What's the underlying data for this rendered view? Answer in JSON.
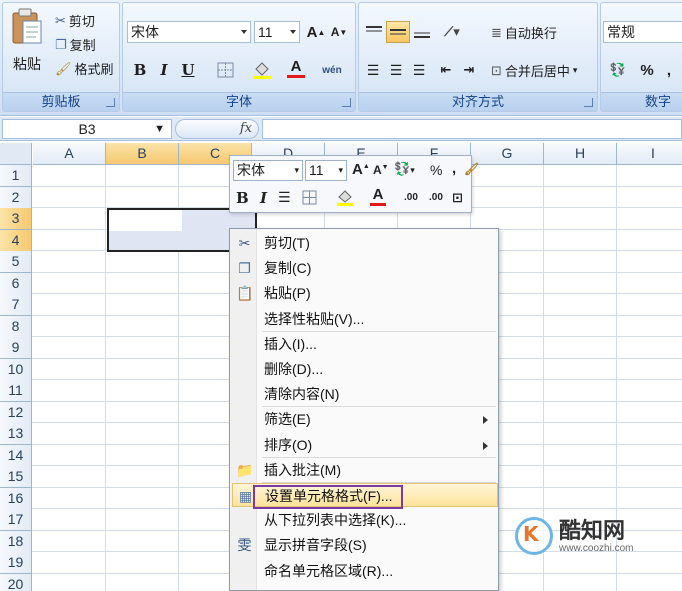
{
  "ribbon": {
    "clipboard": {
      "paste_label": "粘贴",
      "cut_label": "剪切",
      "copy_label": "复制",
      "format_painter_label": "格式刷",
      "group_label": "剪贴板"
    },
    "font": {
      "font_name": "宋体",
      "font_size": "11",
      "grow_label": "A",
      "shrink_label": "A",
      "bold": "B",
      "italic": "I",
      "underline": "U",
      "font_color_label": "A",
      "phonetic_label": "wén",
      "group_label": "字体"
    },
    "alignment": {
      "wrap_text_label": "自动换行",
      "merge_center_label": "合并后居中",
      "group_label": "对齐方式"
    },
    "number": {
      "format_value": "常规",
      "percent": "%",
      "comma": ",",
      "group_label": "数字"
    }
  },
  "formula_bar": {
    "name_box": "B3",
    "fx": "fx"
  },
  "grid": {
    "columns": [
      "A",
      "B",
      "C",
      "D",
      "E",
      "F",
      "G",
      "H",
      "I"
    ],
    "rows": [
      "1",
      "2",
      "3",
      "4",
      "5",
      "6",
      "7",
      "8",
      "9",
      "10",
      "11",
      "12",
      "13",
      "14",
      "15",
      "16",
      "17",
      "18",
      "19",
      "20"
    ]
  },
  "mini_toolbar": {
    "font_name": "宋体",
    "font_size": "11",
    "grow": "A",
    "shrink": "A",
    "percent": "%",
    "comma": ",",
    "bold": "B",
    "italic": "I",
    "font_color": "A",
    "inc_decimal": ".00",
    "dec_decimal": ".00"
  },
  "context_menu": {
    "items": [
      {
        "label": "剪切(T)",
        "icon": "scissors-icon"
      },
      {
        "label": "复制(C)",
        "icon": "copy-icon"
      },
      {
        "label": "粘贴(P)",
        "icon": "paste-icon"
      },
      {
        "label": "选择性粘贴(V)...",
        "icon": ""
      },
      {
        "label": "插入(I)...",
        "icon": ""
      },
      {
        "label": "删除(D)...",
        "icon": ""
      },
      {
        "label": "清除内容(N)",
        "icon": ""
      },
      {
        "label": "筛选(E)",
        "icon": "",
        "submenu": true
      },
      {
        "label": "排序(O)",
        "icon": "",
        "submenu": true
      },
      {
        "label": "插入批注(M)",
        "icon": "comment-icon"
      },
      {
        "label": "设置单元格格式(F)...",
        "icon": "format-cells-icon",
        "highlighted": true
      },
      {
        "label": "从下拉列表中选择(K)...",
        "icon": ""
      },
      {
        "label": "显示拼音字段(S)",
        "icon": "phonetic-icon"
      },
      {
        "label": "命名单元格区域(R)...",
        "icon": ""
      }
    ]
  },
  "watermark": {
    "brand": "酷知网",
    "url": "www.coozhi.com",
    "logo_letter": "K"
  },
  "colors": {
    "highlight_border": "#7b39a8",
    "selected_header": "#f6c86f",
    "ribbon_text": "#15428b"
  }
}
